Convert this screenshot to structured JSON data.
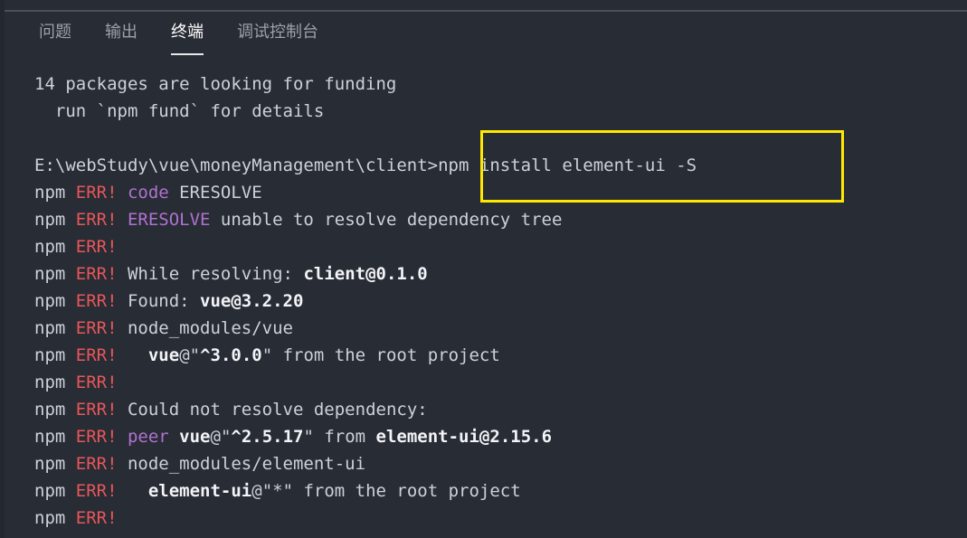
{
  "panel": {
    "background_color": "#282c34",
    "gutter_color": "#23272e",
    "divider_color": "#4a4f59"
  },
  "tabs": [
    {
      "label": "问题",
      "active": false
    },
    {
      "label": "输出",
      "active": false
    },
    {
      "label": "终端",
      "active": true
    },
    {
      "label": "调试控制台",
      "active": false
    }
  ],
  "terminal": {
    "foreground_color": "#cdd2da",
    "error_color": "#e8565a",
    "magenta_color": "#b072d1",
    "prompt_path": "E:\\webStudy\\vue\\moneyManagement\\client>",
    "command": "npm install element-ui -S",
    "lines": [
      {
        "id": "l01",
        "segments": [
          {
            "text": "14 packages are looking for funding",
            "style": "default"
          }
        ]
      },
      {
        "id": "l02",
        "segments": [
          {
            "text": "  run `npm fund` for details",
            "style": "default"
          }
        ]
      },
      {
        "id": "l03",
        "segments": [
          {
            "text": "",
            "style": "default"
          }
        ]
      },
      {
        "id": "l04",
        "segments": [
          {
            "text": "E:\\webStudy\\vue\\moneyManagement\\client>npm install element-ui -S",
            "style": "default"
          }
        ]
      },
      {
        "id": "l05",
        "segments": [
          {
            "text": "npm ",
            "style": "default"
          },
          {
            "text": "ERR! ",
            "style": "err"
          },
          {
            "text": "code ",
            "style": "magenta"
          },
          {
            "text": "ERESOLVE",
            "style": "default"
          }
        ]
      },
      {
        "id": "l06",
        "segments": [
          {
            "text": "npm ",
            "style": "default"
          },
          {
            "text": "ERR! ",
            "style": "err"
          },
          {
            "text": "ERESOLVE",
            "style": "magenta"
          },
          {
            "text": " unable to resolve dependency tree",
            "style": "default"
          }
        ]
      },
      {
        "id": "l07",
        "segments": [
          {
            "text": "npm ",
            "style": "default"
          },
          {
            "text": "ERR!",
            "style": "err"
          }
        ]
      },
      {
        "id": "l08",
        "segments": [
          {
            "text": "npm ",
            "style": "default"
          },
          {
            "text": "ERR! ",
            "style": "err"
          },
          {
            "text": "While resolving: ",
            "style": "default"
          },
          {
            "text": "client@0.1.0",
            "style": "bold"
          }
        ]
      },
      {
        "id": "l09",
        "segments": [
          {
            "text": "npm ",
            "style": "default"
          },
          {
            "text": "ERR! ",
            "style": "err"
          },
          {
            "text": "Found: ",
            "style": "default"
          },
          {
            "text": "vue@3.2.20",
            "style": "bold"
          }
        ]
      },
      {
        "id": "l10",
        "segments": [
          {
            "text": "npm ",
            "style": "default"
          },
          {
            "text": "ERR! ",
            "style": "err"
          },
          {
            "text": "node_modules/vue",
            "style": "default"
          }
        ]
      },
      {
        "id": "l11",
        "segments": [
          {
            "text": "npm ",
            "style": "default"
          },
          {
            "text": "ERR! ",
            "style": "err"
          },
          {
            "text": "  ",
            "style": "default"
          },
          {
            "text": "vue",
            "style": "bold"
          },
          {
            "text": "@\"",
            "style": "default"
          },
          {
            "text": "^3.0.0",
            "style": "bold"
          },
          {
            "text": "\" from the root project",
            "style": "default"
          }
        ]
      },
      {
        "id": "l12",
        "segments": [
          {
            "text": "npm ",
            "style": "default"
          },
          {
            "text": "ERR!",
            "style": "err"
          }
        ]
      },
      {
        "id": "l13",
        "segments": [
          {
            "text": "npm ",
            "style": "default"
          },
          {
            "text": "ERR! ",
            "style": "err"
          },
          {
            "text": "Could not resolve dependency:",
            "style": "default"
          }
        ]
      },
      {
        "id": "l14",
        "segments": [
          {
            "text": "npm ",
            "style": "default"
          },
          {
            "text": "ERR! ",
            "style": "err"
          },
          {
            "text": "peer ",
            "style": "magenta"
          },
          {
            "text": "vue",
            "style": "bold"
          },
          {
            "text": "@\"",
            "style": "default"
          },
          {
            "text": "^2.5.17",
            "style": "bold"
          },
          {
            "text": "\" from ",
            "style": "default"
          },
          {
            "text": "element-ui@2.15.6",
            "style": "bold"
          }
        ]
      },
      {
        "id": "l15",
        "segments": [
          {
            "text": "npm ",
            "style": "default"
          },
          {
            "text": "ERR! ",
            "style": "err"
          },
          {
            "text": "node_modules/element-ui",
            "style": "default"
          }
        ]
      },
      {
        "id": "l16",
        "segments": [
          {
            "text": "npm ",
            "style": "default"
          },
          {
            "text": "ERR! ",
            "style": "err"
          },
          {
            "text": "  ",
            "style": "default"
          },
          {
            "text": "element-ui",
            "style": "bold"
          },
          {
            "text": "@\"*\" from the root project",
            "style": "default"
          }
        ]
      },
      {
        "id": "l17",
        "segments": [
          {
            "text": "npm ",
            "style": "default"
          },
          {
            "text": "ERR!",
            "style": "err"
          }
        ]
      }
    ]
  },
  "annotation": {
    "color": "#ffe800",
    "highlighted_text": "npm install element-ui -S"
  }
}
